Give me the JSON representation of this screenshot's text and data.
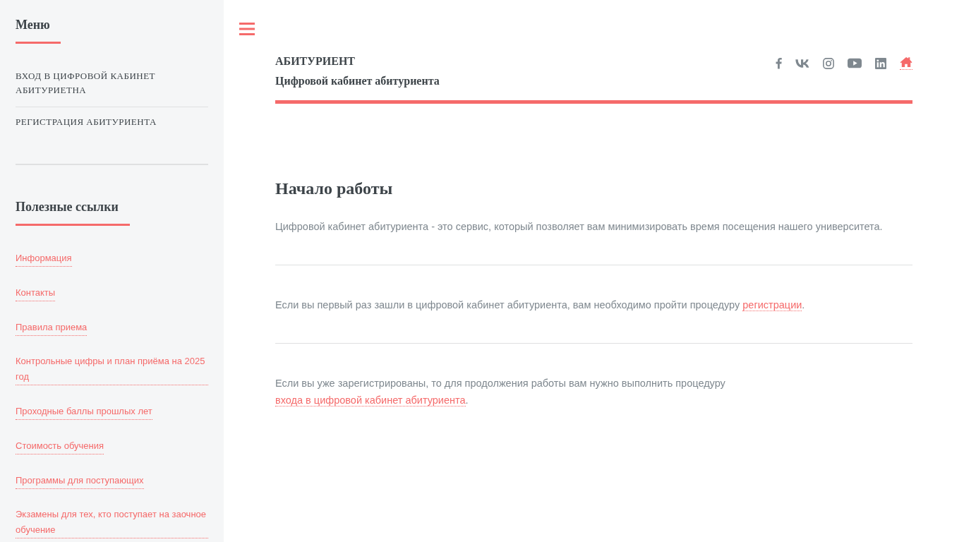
{
  "sidebar": {
    "menu_title": "Меню",
    "menu_items": [
      {
        "label": "ВХОД В ЦИФРОВОЙ КАБИНЕТ АБИТУРИЕТНА"
      },
      {
        "label": "РЕГИСТРАЦИЯ АБИТУРИЕНТА"
      }
    ],
    "links_title": "Полезные ссылки",
    "links": [
      {
        "label": "Информация"
      },
      {
        "label": "Контакты"
      },
      {
        "label": "Правила приема"
      },
      {
        "label": "Контрольные цифры и план приёма на 2025 год"
      },
      {
        "label": "Проходные баллы прошлых лет"
      },
      {
        "label": "Стоимость обучения"
      },
      {
        "label": "Программы для поступающих"
      },
      {
        "label": "Экзамены для тех, кто поступает на заочное обучение"
      }
    ]
  },
  "header": {
    "title": "АБИТУРИЕНТ",
    "subtitle": "Цифровой кабинет абитуриента"
  },
  "content": {
    "heading": "Начало работы",
    "paragraphs": [
      {
        "text": "Цифровой кабинет абитуриента - это сервис, который позволяет вам минимизировать время посещения нашего университета."
      },
      {
        "text": "Если вы первый раз зашли в цифровой кабинет абитуриента, вам необходимо пройти процедуру ",
        "link": "регистрации",
        "after": "."
      },
      {
        "text": "Если вы уже зарегистрированы, то для продолжения работы вам нужно выполнить процедуру ",
        "link": "входа в цифровой кабинет абитуриента",
        "after": "."
      }
    ]
  }
}
